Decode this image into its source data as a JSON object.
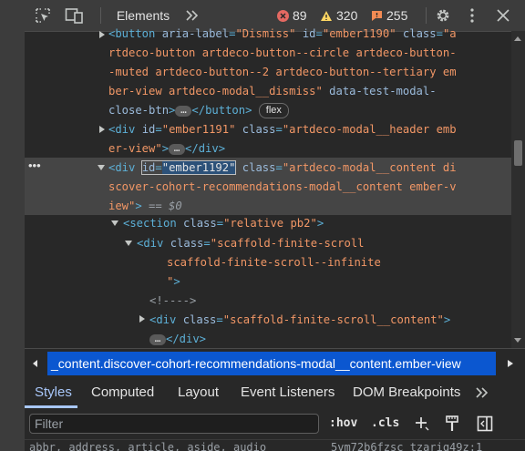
{
  "toolbar": {
    "inspect_icon": "inspect-element-icon",
    "device_icon": "device-toolbar-icon",
    "active_tab": "Elements",
    "more_tabs_icon": "more-tabs-chevron-icon",
    "errors_count": "89",
    "warnings_count": "320",
    "issues_count": "255",
    "settings_icon": "gear-icon",
    "menu_icon": "kebab-menu-icon",
    "close_icon": "close-icon",
    "colors": {
      "error": "#e46962",
      "warning": "#fdd663",
      "issue": "#f28b54"
    }
  },
  "tree": {
    "l1": {
      "tag_open": "<button",
      "a1": "aria-label",
      "v1": "\"Dismiss\"",
      "a2": "id",
      "v2": "\"ember1190\"",
      "a3": "class",
      "v3": "\"a"
    },
    "l2": {
      "v": "rtdeco-button artdeco-button--circle artdeco-button-"
    },
    "l3": {
      "v": "-muted artdeco-button--2 artdeco-button--tertiary em"
    },
    "l4": {
      "v": "ber-view artdeco-modal__dismiss\"",
      "a": "data-test-modal-"
    },
    "l5": {
      "a": "close-btn",
      "close": "</button>",
      "badge": "flex"
    },
    "l6": {
      "tag_open": "<div",
      "a1": "id",
      "v1": "\"ember1191\"",
      "a2": "class",
      "v2": "\"artdeco-modal__header emb"
    },
    "l7": {
      "v": "er-view\"",
      "close": "</div>"
    },
    "l8": {
      "tag_open": "<div",
      "a1": "id",
      "v1": "\"ember1192\"",
      "a2": "class",
      "v2": "\"artdeco-modal__content di"
    },
    "l9": {
      "v": "scover-cohort-recommendations-modal__content ember-v"
    },
    "l10": {
      "v": "iew\"",
      "eq": "== $0"
    },
    "l11": {
      "tag_open": "<section",
      "a": "class",
      "v": "\"relative pb2\"",
      "end": ">"
    },
    "l12": {
      "tag_open": "<div",
      "a": "class",
      "v": "\"scaffold-finite-scroll"
    },
    "l13": {
      "v": "scaffold-finite-scroll--infinite"
    },
    "l14": {
      "v": "\"",
      "end": ">"
    },
    "l15": {
      "comment": "<!---->"
    },
    "l16": {
      "tag_open": "<div",
      "a": "class",
      "v": "\"scaffold-finite-scroll__content\"",
      "end": ">"
    },
    "l17": {
      "close": "</div>"
    },
    "dots": "•••",
    "ellipsis": "…"
  },
  "breadcrumb": {
    "text": "_content.discover-cohort-recommendations-modal__content.ember-view",
    "left_icon": "chevron-left-icon",
    "right_icon": "chevron-right-icon"
  },
  "subtabs": [
    "Styles",
    "Computed",
    "Layout",
    "Event Listeners",
    "DOM Breakpoints"
  ],
  "subtabs_more_icon": "more-tabs-chevron-icon",
  "filter": {
    "placeholder": "Filter",
    "hov": ":hov",
    "cls": ".cls",
    "add_icon": "new-style-rule-icon",
    "paint_icon": "element-state-icon",
    "sidebar_icon": "toggle-sidebar-icon"
  },
  "bottom": {
    "tags": "abbr, address, article, aside, audio",
    "source": "5vm72b6fzsc tzariq49z:1"
  }
}
